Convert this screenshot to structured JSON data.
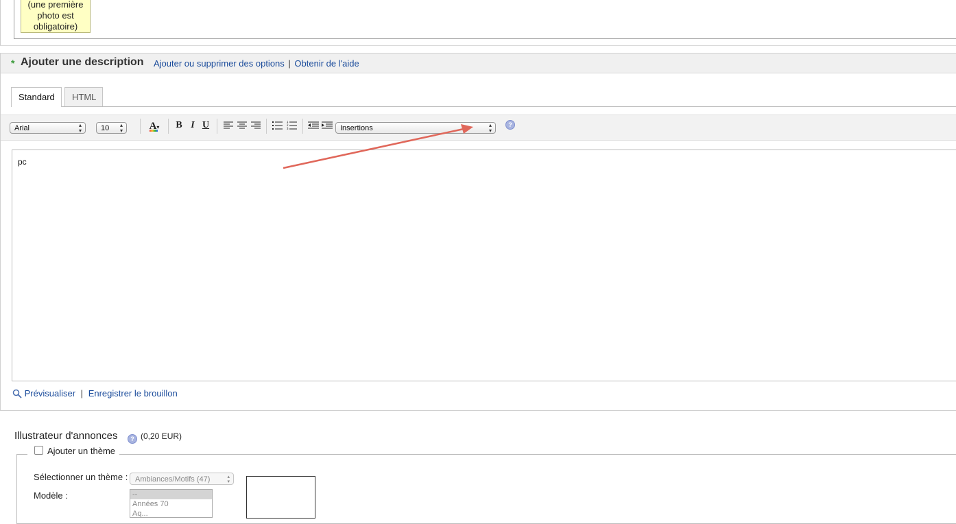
{
  "photo_note": {
    "line1": "(une première",
    "line2": "photo est",
    "line3": "obligatoire)"
  },
  "description": {
    "required_marker": "*",
    "title": "Ajouter une description",
    "link_options": "Ajouter ou supprimer des options",
    "separator": "|",
    "link_help": "Obtenir de l'aide"
  },
  "tabs": [
    {
      "label": "Standard",
      "active": true
    },
    {
      "label": "HTML",
      "active": false
    }
  ],
  "toolbar": {
    "font_value": "Arial",
    "size_value": "10",
    "font_color_glyph": "A",
    "bold_glyph": "B",
    "italic_glyph": "I",
    "underline_glyph": "U",
    "insertions_value": "Insertions",
    "help_glyph": "?",
    "icons": [
      "font-color-icon",
      "bold-icon",
      "italic-icon",
      "underline-icon",
      "align-left-icon",
      "align-center-icon",
      "align-right-icon",
      "bullet-list-icon",
      "numbered-list-icon",
      "outdent-icon",
      "indent-icon",
      "help-icon"
    ]
  },
  "editor": {
    "content": "pc"
  },
  "preview_links": {
    "preview": "Prévisualiser",
    "separator": "|",
    "save_draft": "Enregistrer le brouillon"
  },
  "illustrator": {
    "title": "Illustrateur d'annonces",
    "price": "(0,20 EUR)",
    "checkbox_label": "Ajouter un thème",
    "select_theme_label": "Sélectionner un thème :",
    "theme_value": "Ambiances/Motifs (47)",
    "model_label": "Modèle :",
    "model_options": [
      "--",
      "Années 70",
      "Aq..."
    ]
  },
  "colors": {
    "link": "#1a4b9b",
    "note_bg": "#ffffc4",
    "annotation_arrow": "#e0675a",
    "required_star": "#3a9a3a"
  }
}
